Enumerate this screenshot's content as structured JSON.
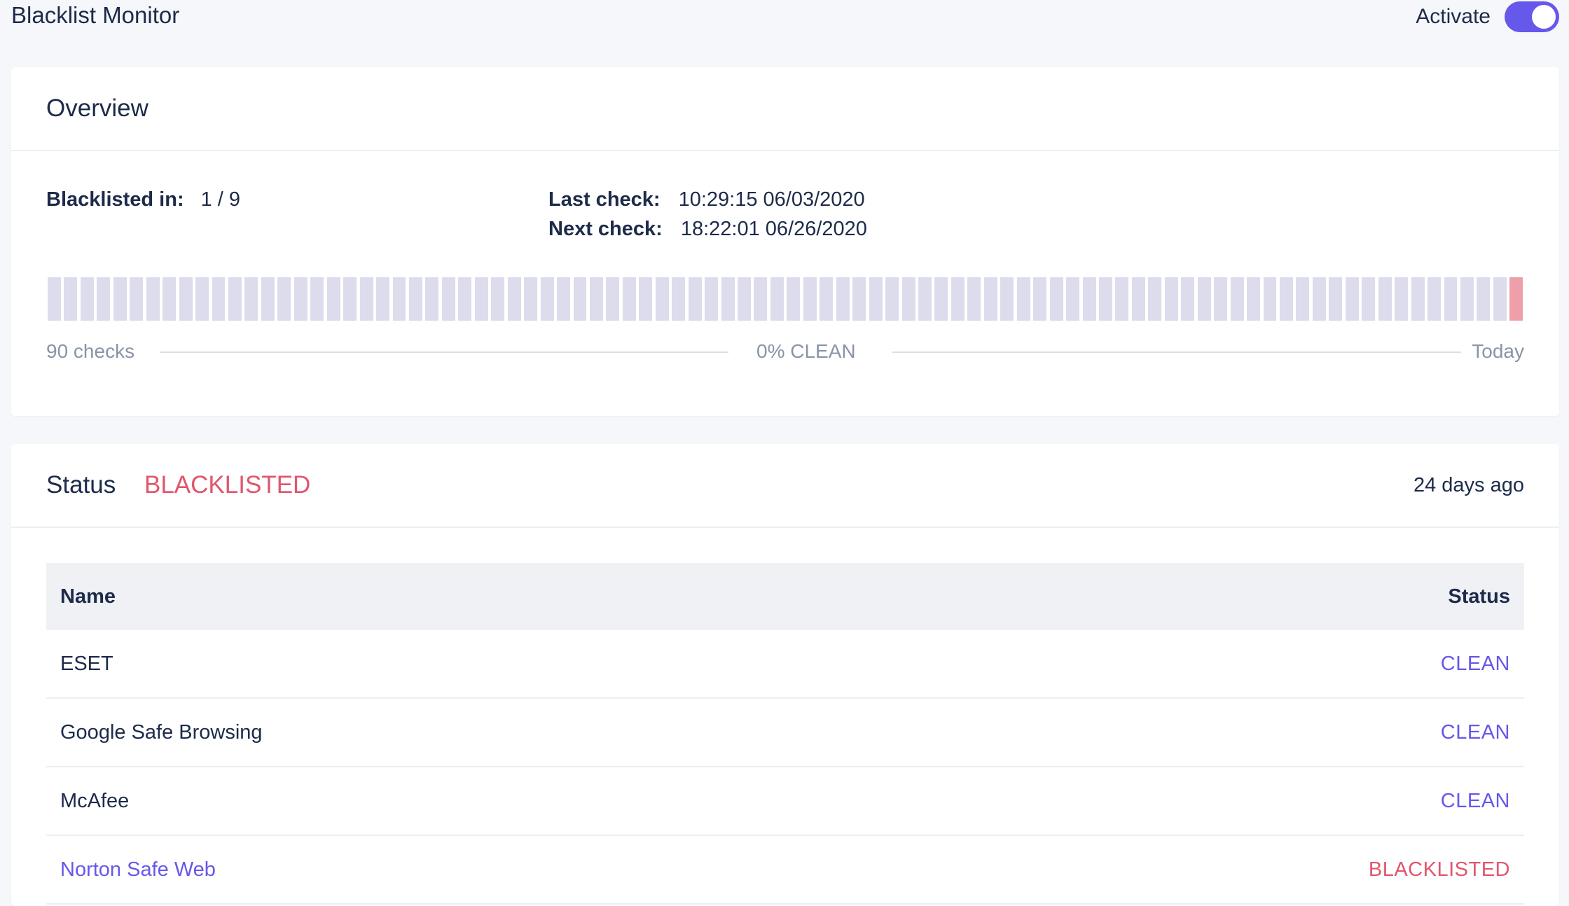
{
  "app": {
    "title": "Blacklist Monitor",
    "activate_label": "Activate",
    "activate_on": true
  },
  "overview": {
    "title": "Overview",
    "blacklisted_label": "Blacklisted in:",
    "blacklisted_value": "1 / 9",
    "last_check_label": "Last check:",
    "last_check_value": "10:29:15 06/03/2020",
    "next_check_label": "Next check:",
    "next_check_value": "18:22:01 06/26/2020",
    "history": {
      "total_checks": 90,
      "bad_indices": [
        89
      ],
      "left_label": "90 checks",
      "center_label": "0% CLEAN",
      "right_label": "Today"
    }
  },
  "status": {
    "label": "Status",
    "value": "BLACKLISTED",
    "ago": "24 days ago",
    "table": {
      "col_name": "Name",
      "col_status": "Status",
      "rows": [
        {
          "name": "ESET",
          "status": "CLEAN"
        },
        {
          "name": "Google Safe Browsing",
          "status": "CLEAN"
        },
        {
          "name": "McAfee",
          "status": "CLEAN"
        },
        {
          "name": "Norton Safe Web",
          "status": "BLACKLISTED"
        }
      ]
    }
  },
  "colors": {
    "accent": "#6658ea",
    "danger": "#e0566c",
    "bar_clean": "#dcdcec",
    "bar_bad": "#ee9fa9"
  }
}
